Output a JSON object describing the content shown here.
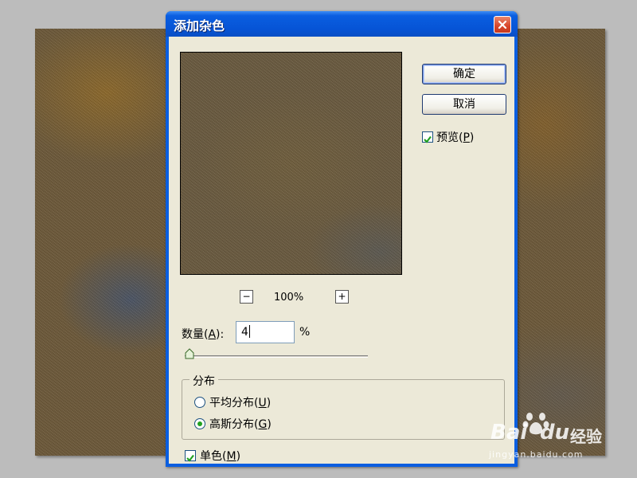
{
  "dialog": {
    "title": "添加杂色",
    "close_icon": "close-icon"
  },
  "preview": {
    "zoom_out_label": "−",
    "zoom_in_label": "+",
    "zoom_level": "100%"
  },
  "buttons": {
    "ok_label": "确定",
    "cancel_label": "取消"
  },
  "preview_toggle": {
    "label": "预览(",
    "mnemonic": "P",
    "label_end": ")",
    "checked": true
  },
  "amount": {
    "label": "数量(",
    "mnemonic": "A",
    "label_end": "):",
    "value": "4",
    "unit": "%",
    "slider_fraction": 0.0
  },
  "distribution": {
    "legend": "分布",
    "options": [
      {
        "label": "平均分布(",
        "mnemonic": "U",
        "label_end": ")",
        "selected": false
      },
      {
        "label": "高斯分布(",
        "mnemonic": "G",
        "label_end": ")",
        "selected": true
      }
    ]
  },
  "monochromatic": {
    "label": "单色(",
    "mnemonic": "M",
    "label_end": ")",
    "checked": true
  },
  "watermark": {
    "brand": "Bai",
    "brand2": "du",
    "suffix": "经验",
    "url": "jingyan.baidu.com"
  },
  "colors": {
    "title_bar": "#0a5ee0",
    "dialog_face": "#ece9d8",
    "check_green": "#21a121",
    "canvas_brown": "#6e5a3a"
  }
}
